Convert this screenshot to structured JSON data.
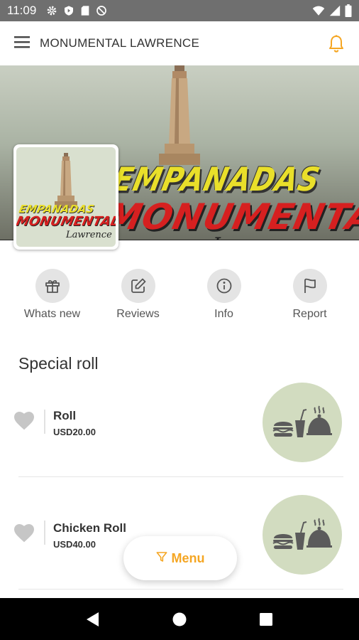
{
  "status_bar": {
    "time": "11:09",
    "icons": [
      "gear-icon",
      "shield-icon",
      "sd-card-icon",
      "no-sim-icon"
    ],
    "right_icons": [
      "wifi-icon",
      "signal-icon",
      "battery-icon"
    ]
  },
  "app_bar": {
    "title": "MONUMENTAL LAWRENCE",
    "accent_color": "#f5a623"
  },
  "banner": {
    "line1": "EMPANADAS",
    "line2": "MONUMENTAL",
    "line3": "Lawrence"
  },
  "logo": {
    "line1": "EMPANADAS",
    "line2": "MONUMENTAL",
    "line3": "Lawrence"
  },
  "actions": [
    {
      "label": "Whats new",
      "icon": "gift-icon"
    },
    {
      "label": "Reviews",
      "icon": "edit-icon"
    },
    {
      "label": "Info",
      "icon": "info-icon"
    },
    {
      "label": "Report",
      "icon": "flag-icon"
    }
  ],
  "section": {
    "title": "Special roll"
  },
  "items": [
    {
      "name": "Roll",
      "price": "USD20.00",
      "image_icon": "food-icon"
    },
    {
      "name": "Chicken Roll",
      "price": "USD40.00",
      "image_icon": "food-icon"
    }
  ],
  "menu_button": {
    "label": "Menu",
    "icon": "filter-icon"
  },
  "nav_bar": {
    "icons": [
      "back-icon",
      "home-icon",
      "recents-icon"
    ]
  }
}
